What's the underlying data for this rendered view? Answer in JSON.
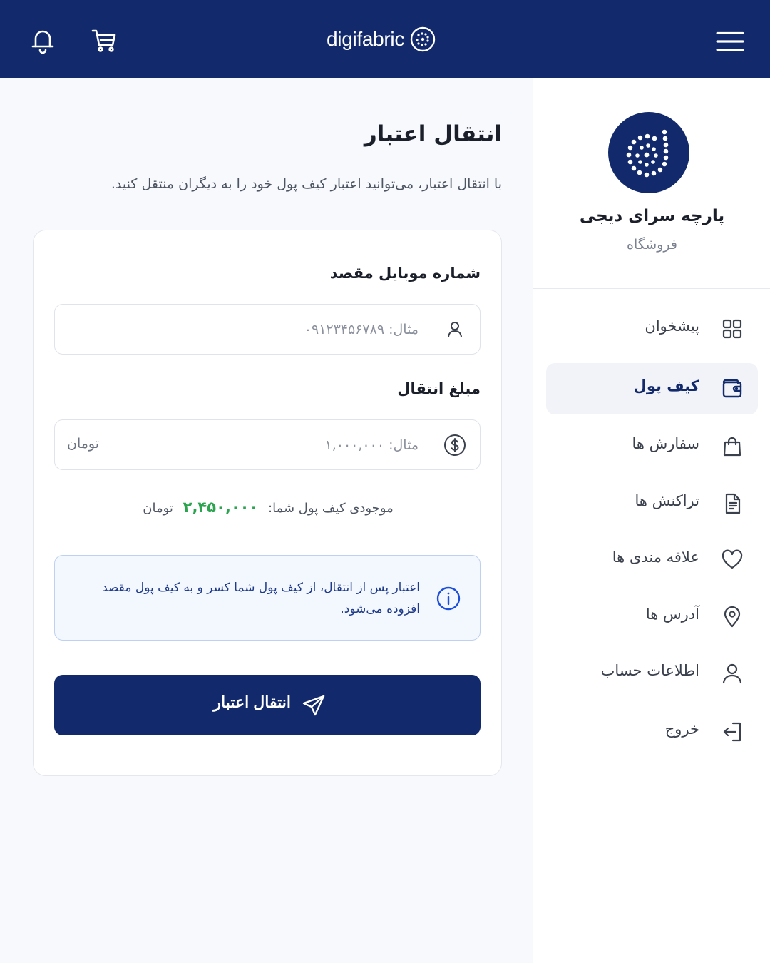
{
  "header": {
    "brand": "digifabric",
    "icons": {
      "menu": "menu-icon",
      "bell": "bell-icon",
      "cart": "cart-icon"
    }
  },
  "sidebar": {
    "store_name": "پارچه سرای دیجی",
    "store_role": "فروشگاه",
    "items": [
      {
        "label": "پیشخوان",
        "icon": "grid-icon",
        "active": false
      },
      {
        "label": "کیف پول",
        "icon": "wallet-icon",
        "active": true
      },
      {
        "label": "سفارش ها",
        "icon": "shopping-bag-icon",
        "active": false
      },
      {
        "label": "تراکنش ها",
        "icon": "document-icon",
        "active": false
      },
      {
        "label": "علاقه مندی ها",
        "icon": "heart-icon",
        "active": false
      },
      {
        "label": "آدرس ها",
        "icon": "location-pin-icon",
        "active": false
      },
      {
        "label": "اطلاعات حساب",
        "icon": "user-icon",
        "active": false
      },
      {
        "label": "خروج",
        "icon": "logout-icon",
        "active": false
      }
    ]
  },
  "main": {
    "title": "انتقال اعتبار",
    "description": "با انتقال اعتبار، می‌توانید اعتبار کیف پول خود را به دیگران منتقل کنید.",
    "form": {
      "phone_label": "شماره موبایل مقصد",
      "phone_placeholder": "مثال: ۰۹۱۲۳۴۵۶۷۸۹",
      "phone_value": "",
      "amount_label": "مبلغ انتقال",
      "amount_placeholder": "مثال: ۱,۰۰۰,۰۰۰",
      "amount_value": "",
      "amount_unit": "تومان"
    },
    "balance": {
      "label": "موجودی کیف پول شما:",
      "amount": "۲,۴۵۰,۰۰۰",
      "unit": "تومان"
    },
    "info": "اعتبار پس از انتقال، از کیف پول شما کسر و به کیف پول مقصد افزوده می‌شود.",
    "submit_label": "انتقال اعتبار"
  },
  "colors": {
    "primary": "#122a6b",
    "accent_green": "#2aa44f",
    "info_bg": "#f3f7fe",
    "info_border": "#bfd1f0",
    "page_bg": "#f7f9fc"
  }
}
